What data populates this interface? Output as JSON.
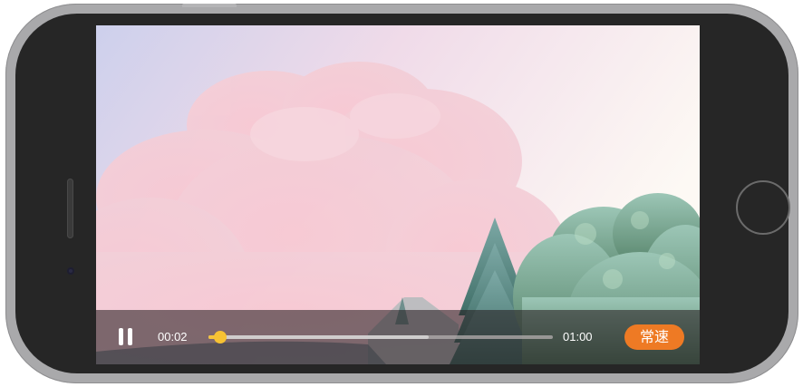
{
  "player": {
    "current_time": "00:02",
    "total_time": "01:00",
    "progress_fraction": 0.035,
    "buffered_fraction": 0.64,
    "speed_label": "常速",
    "state": "playing",
    "controls": {
      "pause_icon": "pause-icon"
    }
  },
  "colors": {
    "accent": "#ee7a24",
    "progress": "#f5c33b",
    "control_bar": "rgba(40,30,32,0.58)",
    "device_frame": "#a9a9ab",
    "device_bezel": "#262626"
  }
}
